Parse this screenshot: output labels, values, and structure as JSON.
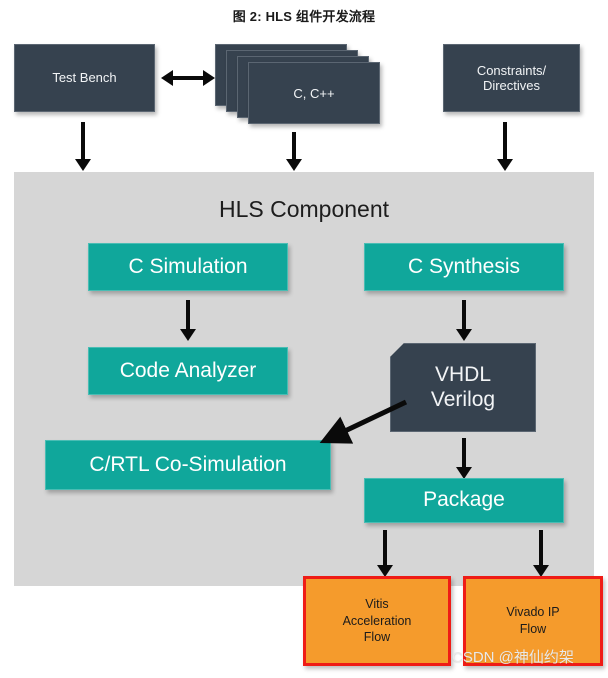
{
  "figure": {
    "title": "图 2: HLS 组件开发流程"
  },
  "panel": {
    "title": "HLS Component",
    "bg_color": "#d6d6d6"
  },
  "colors": {
    "dark_node": "#36424f",
    "teal_node": "#10a79b",
    "orange_node": "#f59b2c",
    "orange_border": "#ef1c16",
    "arrow": "#0a0a0a",
    "page_bg": "#ffffff"
  },
  "inputs": [
    {
      "id": "test-bench",
      "label": "Test Bench"
    },
    {
      "id": "c-cpp",
      "label": "C, C++"
    },
    {
      "id": "constraints",
      "label_line1": "Constraints/",
      "label_line2": "Directives"
    }
  ],
  "stages": {
    "c_simulation": "C Simulation",
    "code_analyzer": "Code Analyzer",
    "c_rtl_cosimulation": "C/RTL Co-Simulation",
    "c_synthesis": "C Synthesis",
    "vhdl_line1": "VHDL",
    "vhdl_line2": "Verilog",
    "package": "Package"
  },
  "outputs": [
    {
      "id": "vitis-acceleration-flow",
      "line1": "Vitis",
      "line2": "Acceleration",
      "line3": "Flow"
    },
    {
      "id": "vivado-ip-flow",
      "line1": "Vivado IP",
      "line2": "Flow"
    }
  ],
  "watermark": {
    "text": "CSDN @神仙约架"
  }
}
